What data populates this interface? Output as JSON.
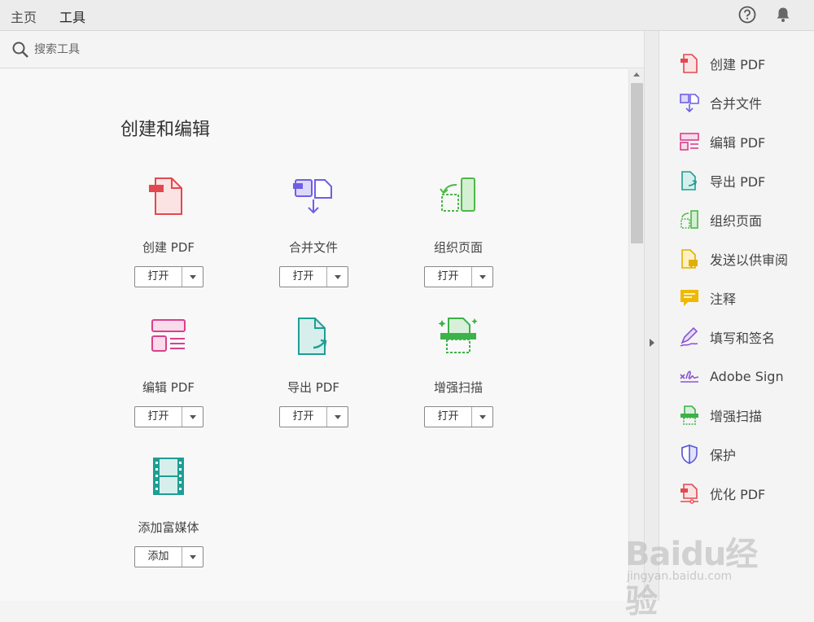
{
  "tabs": [
    {
      "label": "主页",
      "active": false
    },
    {
      "label": "工具",
      "active": true
    }
  ],
  "top_icons": [
    "help-icon",
    "bell-icon"
  ],
  "search": {
    "placeholder": "搜索工具"
  },
  "section": {
    "title": "创建和编辑"
  },
  "tools": [
    {
      "name": "创建 PDF",
      "button": "打开",
      "icon": "create-pdf-icon",
      "color": "#e34850"
    },
    {
      "name": "合并文件",
      "button": "打开",
      "icon": "combine-files-icon",
      "color": "#6e5fe6"
    },
    {
      "name": "组织页面",
      "button": "打开",
      "icon": "organize-pages-icon",
      "color": "#4db848"
    },
    {
      "name": "编辑 PDF",
      "button": "打开",
      "icon": "edit-pdf-icon",
      "color": "#d8418d"
    },
    {
      "name": "导出 PDF",
      "button": "打开",
      "icon": "export-pdf-icon",
      "color": "#1e9e94"
    },
    {
      "name": "增强扫描",
      "button": "打开",
      "icon": "enhance-scan-icon",
      "color": "#3cb24a"
    },
    {
      "name": "添加富媒体",
      "button": "添加",
      "icon": "rich-media-icon",
      "color": "#1e9e94"
    }
  ],
  "right_panel": [
    {
      "label": "创建 PDF",
      "icon": "create-pdf-icon"
    },
    {
      "label": "合并文件",
      "icon": "combine-files-icon"
    },
    {
      "label": "编辑 PDF",
      "icon": "edit-pdf-icon"
    },
    {
      "label": "导出 PDF",
      "icon": "export-pdf-icon"
    },
    {
      "label": "组织页面",
      "icon": "organize-pages-icon"
    },
    {
      "label": "发送以供审阅",
      "icon": "send-review-icon"
    },
    {
      "label": "注释",
      "icon": "comment-icon"
    },
    {
      "label": "填写和签名",
      "icon": "fill-sign-icon"
    },
    {
      "label": "Adobe Sign",
      "icon": "adobe-sign-icon"
    },
    {
      "label": "增强扫描",
      "icon": "enhance-scan-icon"
    },
    {
      "label": "保护",
      "icon": "protect-icon"
    },
    {
      "label": "优化 PDF",
      "icon": "optimize-pdf-icon"
    }
  ],
  "watermark": {
    "main": "Baidu经验",
    "sub": "jingyan.baidu.com"
  }
}
